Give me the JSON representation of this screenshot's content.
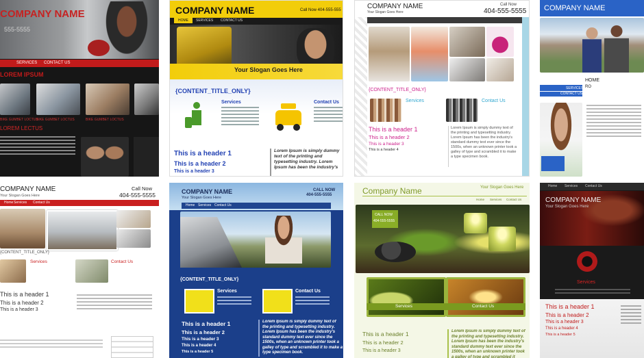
{
  "tiles": [
    {
      "company": "COMPANY NAME",
      "phone": "555-5555",
      "nav": [
        "SERVICES",
        "CONTACT US"
      ],
      "headline": "LOREM IPSUM",
      "cap1": "BIKE GUMBET LOCTUS",
      "cap2": "BIKE GUMBET LOCTUS",
      "cap3": "BIKE GUMBET LOCTUS",
      "lorem": "LOREM LECTUS"
    },
    {
      "company": "COMPANY NAME",
      "phone": "Call Now 404-555-555",
      "nav": [
        "HOME",
        "SERVICES",
        "CONTACT US"
      ],
      "slogan": "Your Slogan Goes Here",
      "content_title": "{CONTENT_TITLE_ONLY}",
      "services": "Services",
      "contact": "Contact Us",
      "h1": "This is a header 1",
      "h2": "This is a header 2",
      "h3": "This is a header 3",
      "lorem": "Lorem Ipsum is simply dummy text of the printing and typesetting industry. Lorem Ipsum has been the industry's"
    },
    {
      "company": "COMPANY NAME",
      "slogan": "Your Slogan Goes Here",
      "phone_label": "Call Now",
      "phone": "404-555-5555",
      "content_title": "{CONTENT_TITLE_ONLY}",
      "services": "Services",
      "contact": "Contact Us",
      "h1": "This is a header 1",
      "h2": "This is a header 2",
      "h3": "This is a header 3",
      "h4": "This is a header 4",
      "lorem": "Lorem Ipsum is simply dummy text of the printing and typesetting industry. Lorem Ipsum has been the industry's standard dummy text ever since the 1500s, when an unknown printer took a galley of type and scrambled it to make a type specimen book."
    },
    {
      "company": "COMPANY NAME",
      "nav": [
        "HOME",
        "RO",
        "SERVICES",
        "CONTACT US"
      ]
    },
    {
      "company": "COMPANY NAME",
      "slogan": "Your Slogan Goes Here",
      "phone_label": "Call Now",
      "phone": "404-555-5555",
      "nav": [
        "Home",
        "Services",
        "Contact Us"
      ],
      "content_title": "{CONTENT_TITLE_ONLY}",
      "services": "Services",
      "contact": "Contact Us",
      "h1": "This is a header 1",
      "h2": "This is a header 2",
      "h3": "This is a header 3"
    },
    {
      "company": "COMPANY NAME",
      "phone_label": "CALL NOW",
      "phone": "404-555-5555",
      "slogan": "Your Slogan Goes Here",
      "nav": [
        "Home",
        "Services",
        "Contact Us"
      ],
      "content_title": "{CONTENT_TITLE_ONLY}",
      "services": "Services",
      "contact": "Contact Us",
      "h1": "This is a header 1",
      "h2": "This is a header 2",
      "h3": "This is a header 3",
      "h4": "This is a header 4",
      "h5": "This is a header 5",
      "lorem": "Lorem Ipsum is simply dummy text of the printing and typesetting industry. Lorem Ipsum has been the industry's standard dummy text ever since the 1500s, when an unknown printer took a galley of type and scrambled it to make a type specimen book."
    },
    {
      "company": "Company Name",
      "slogan": "Your Slogan Goes Here",
      "nav": [
        "Home",
        "Services",
        "Contact Us"
      ],
      "call_now": "CALL NOW",
      "phone": "404-555-5555",
      "services": "Services",
      "contact": "Contact Us",
      "h1": "This is a header 1",
      "h2": "This is a header 2",
      "h3": "This is a header 3",
      "lorem": "Lorem Ipsum is simply dummy text of the printing and typesetting industry. Lorem Ipsum has been the industry's standard dummy text ever since the 1500s, when an unknown printer took a galley of type and scrambled it"
    },
    {
      "company": "COMPANY NAME",
      "slogan": "Your Slogan Goes Here",
      "nav": [
        "Home",
        "Services",
        "Contact Us"
      ],
      "services": "Services",
      "h1": "This is a header 1",
      "h2": "This is a header 2",
      "h3": "This is a header 3",
      "h4": "This is a header 4",
      "h5": "This is a header 5"
    }
  ]
}
